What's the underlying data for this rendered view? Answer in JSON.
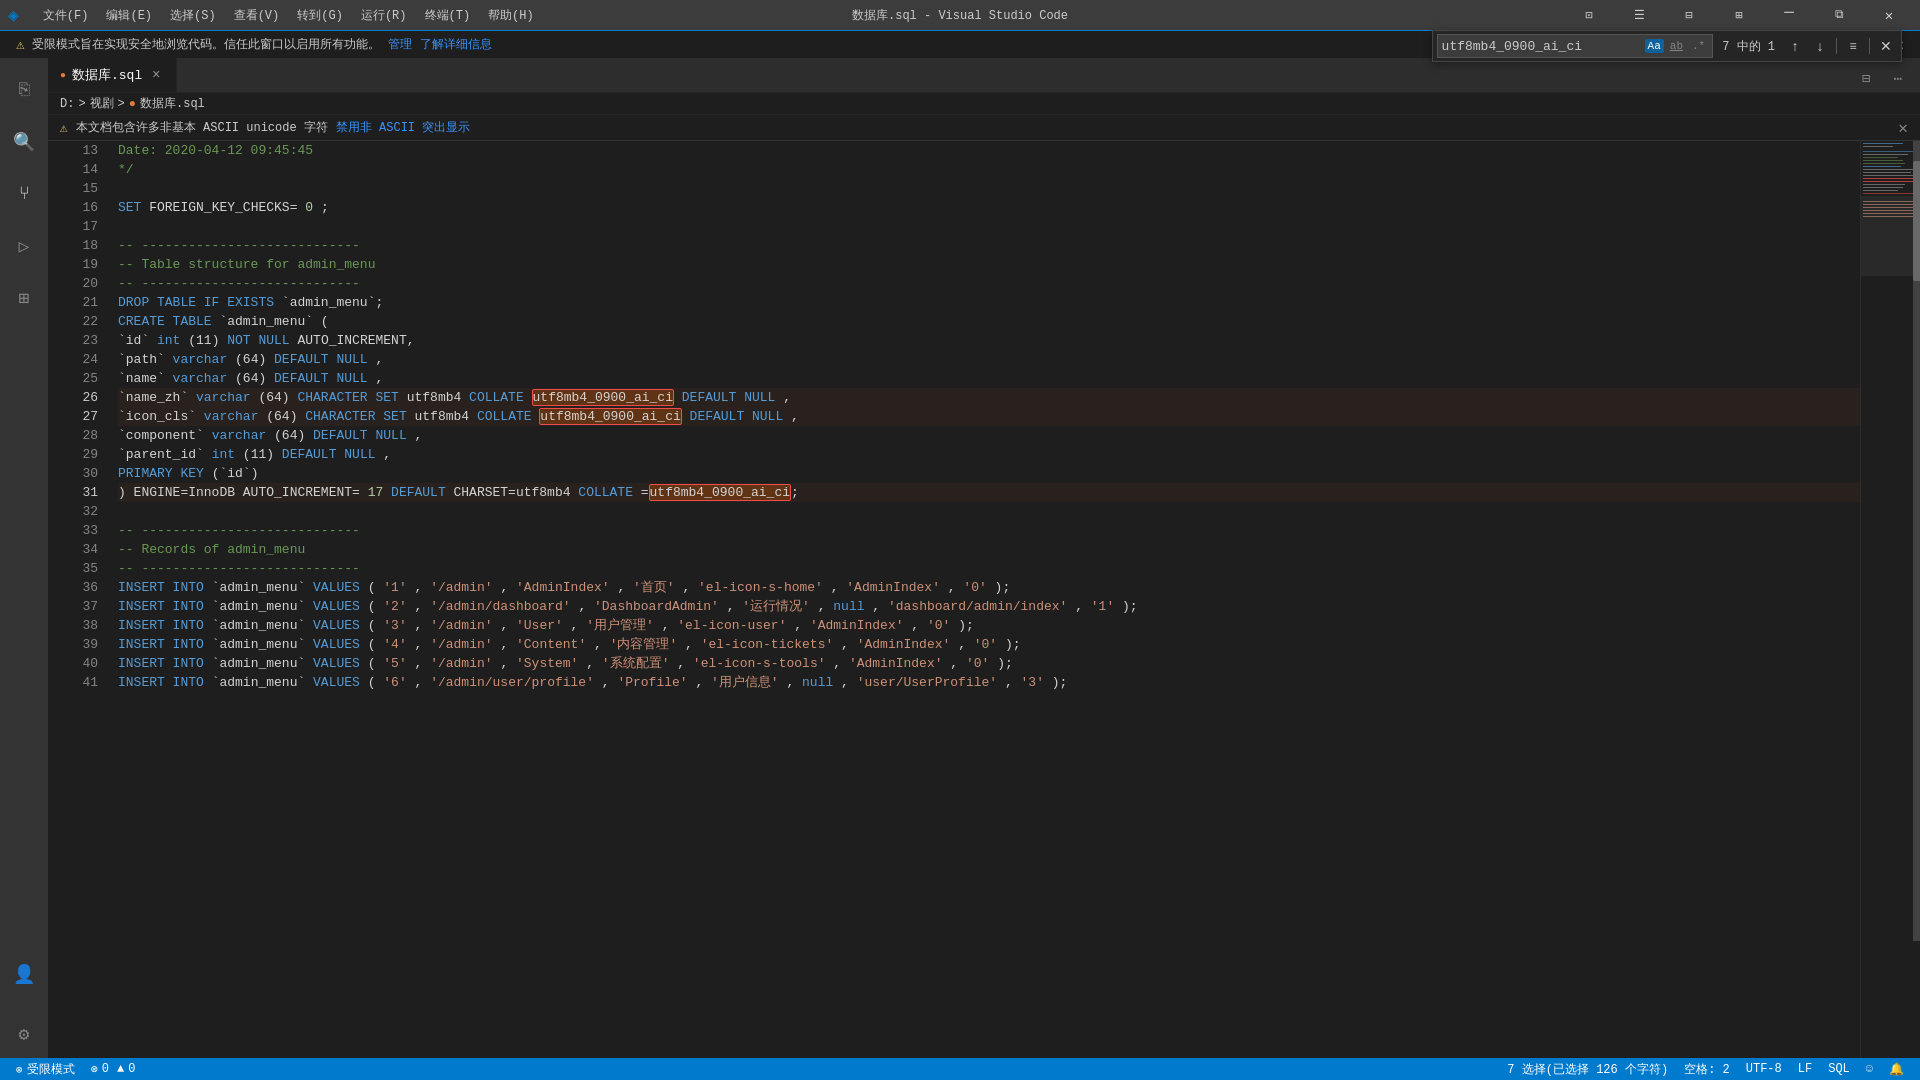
{
  "titlebar": {
    "logo": "◈",
    "menus": [
      "文件(F)",
      "编辑(E)",
      "选择(S)",
      "查看(V)",
      "转到(G)",
      "运行(R)",
      "终端(T)",
      "帮助(H)"
    ],
    "title": "数据库.sql - Visual Studio Code",
    "win_min": "─",
    "win_restore": "□",
    "win_max": "□",
    "win_layout": "⊞",
    "win_close": "✕"
  },
  "restricted_bar": {
    "text": "受限模式旨在实现安全地浏览代码。信任此窗口以启用所有功能。",
    "manage": "管理",
    "learn_more": "了解详细信息"
  },
  "tab": {
    "icon": "●",
    "name": "数据库.sql",
    "close": "×"
  },
  "breadcrumb": {
    "drive": "D:",
    "sep1": ">",
    "folder": "视剧",
    "sep2": ">",
    "icon": "●",
    "file": "数据库.sql"
  },
  "warning": {
    "text": "本文档包含许多非基本 ASCII unicode 字符",
    "action": "禁用非 ASCII 突出显示"
  },
  "find_widget": {
    "placeholder": "utf8mb4_0900_ai_ci",
    "value": "utf8mb4_0900_ai_ci",
    "count": "7 中的 1",
    "btn_case": "Aa",
    "btn_word": "ab",
    "btn_regex": ".*",
    "btn_prev": "↑",
    "btn_next": "↓",
    "btn_all": "≡",
    "btn_close": "×"
  },
  "lines": [
    {
      "num": 13,
      "content": "    Date: 2020-04-12 09:45:45",
      "type": "comment"
    },
    {
      "num": 14,
      "content": "    */",
      "type": "comment"
    },
    {
      "num": 15,
      "content": "",
      "type": "empty"
    },
    {
      "num": 16,
      "content": "SET FOREIGN_KEY_CHECKS=0;",
      "type": "code"
    },
    {
      "num": 17,
      "content": "",
      "type": "empty"
    },
    {
      "num": 18,
      "content": "-- ----------------------------",
      "type": "comment"
    },
    {
      "num": 19,
      "content": "-- Table structure for admin_menu",
      "type": "comment"
    },
    {
      "num": 20,
      "content": "-- ----------------------------",
      "type": "comment"
    },
    {
      "num": 21,
      "content": "DROP TABLE IF EXISTS `admin_menu`;",
      "type": "code"
    },
    {
      "num": 22,
      "content": "CREATE TABLE `admin_menu` (",
      "type": "code"
    },
    {
      "num": 23,
      "content": "  `id` int(11) NOT NULL AUTO_INCREMENT,",
      "type": "code"
    },
    {
      "num": 24,
      "content": "  `path` varchar(64) DEFAULT NULL,",
      "type": "code"
    },
    {
      "num": 25,
      "content": "  `name` varchar(64) DEFAULT NULL,",
      "type": "code"
    },
    {
      "num": 26,
      "content": "  `name_zh` varchar(64) CHARACTER SET utf8mb4 COLLATE utf8mb4_0900_ai_ci DEFAULT NULL,",
      "type": "code_highlight1"
    },
    {
      "num": 27,
      "content": "  `icon_cls` varchar(64) CHARACTER SET utf8mb4 COLLATE utf8mb4_0900_ai_ci DEFAULT NULL,",
      "type": "code_highlight2"
    },
    {
      "num": 28,
      "content": "  `component` varchar(64) DEFAULT NULL,",
      "type": "code"
    },
    {
      "num": 29,
      "content": "  `parent_id` int(11) DEFAULT NULL,",
      "type": "code"
    },
    {
      "num": 30,
      "content": "  PRIMARY KEY (`id`)",
      "type": "code"
    },
    {
      "num": 31,
      "content": ") ENGINE=InnoDB AUTO_INCREMENT=17 DEFAULT CHARSET=utf8mb4 COLLATE=utf8mb4_0900_ai_ci;",
      "type": "code_highlight3"
    },
    {
      "num": 32,
      "content": "",
      "type": "empty"
    },
    {
      "num": 33,
      "content": "-- ----------------------------",
      "type": "comment"
    },
    {
      "num": 34,
      "content": "-- Records of admin_menu",
      "type": "comment"
    },
    {
      "num": 35,
      "content": "-- ----------------------------",
      "type": "comment"
    },
    {
      "num": 36,
      "content": "INSERT INTO `admin_menu` VALUES ('1', '/admin', 'AdminIndex', '首页', 'el-icon-s-home', 'AdminIndex', '0');",
      "type": "code"
    },
    {
      "num": 37,
      "content": "INSERT INTO `admin_menu` VALUES ('2', '/admin/dashboard', 'DashboardAdmin', '运行情况', null, 'dashboard/admin/index', '1');",
      "type": "code"
    },
    {
      "num": 38,
      "content": "INSERT INTO `admin_menu` VALUES ('3', '/admin', 'User', '用户管理', 'el-icon-user', 'AdminIndex', '0');",
      "type": "code"
    },
    {
      "num": 39,
      "content": "INSERT INTO `admin_menu` VALUES ('4', '/admin', 'Content', '内容管理', 'el-icon-tickets', 'AdminIndex', '0');",
      "type": "code"
    },
    {
      "num": 40,
      "content": "INSERT INTO `admin_menu` VALUES ('5', '/admin', 'System', '系统配置', 'el-icon-s-tools', 'AdminIndex', '0');",
      "type": "code"
    },
    {
      "num": 41,
      "content": "INSERT INTO `admin_menu` VALUES ('6', '/admin/user/profile', 'Profile', '用户信息', null, 'user/UserProfile', '3');",
      "type": "code"
    }
  ],
  "status": {
    "mode": "受限模式",
    "errors": "⊗ 0",
    "warnings": "▲ 0",
    "selection": "7 选择(已选择 126 个字符)",
    "spaces": "空格: 2",
    "encoding": "UTF-8",
    "line_ending": "LF",
    "language": "SQL",
    "feedback": "☺",
    "bell": "🔔"
  },
  "activity_icons": [
    "⎘",
    "🔍",
    "⑂",
    "▷",
    "⊞"
  ],
  "bottom_icons": [
    "👤",
    "⚙"
  ]
}
